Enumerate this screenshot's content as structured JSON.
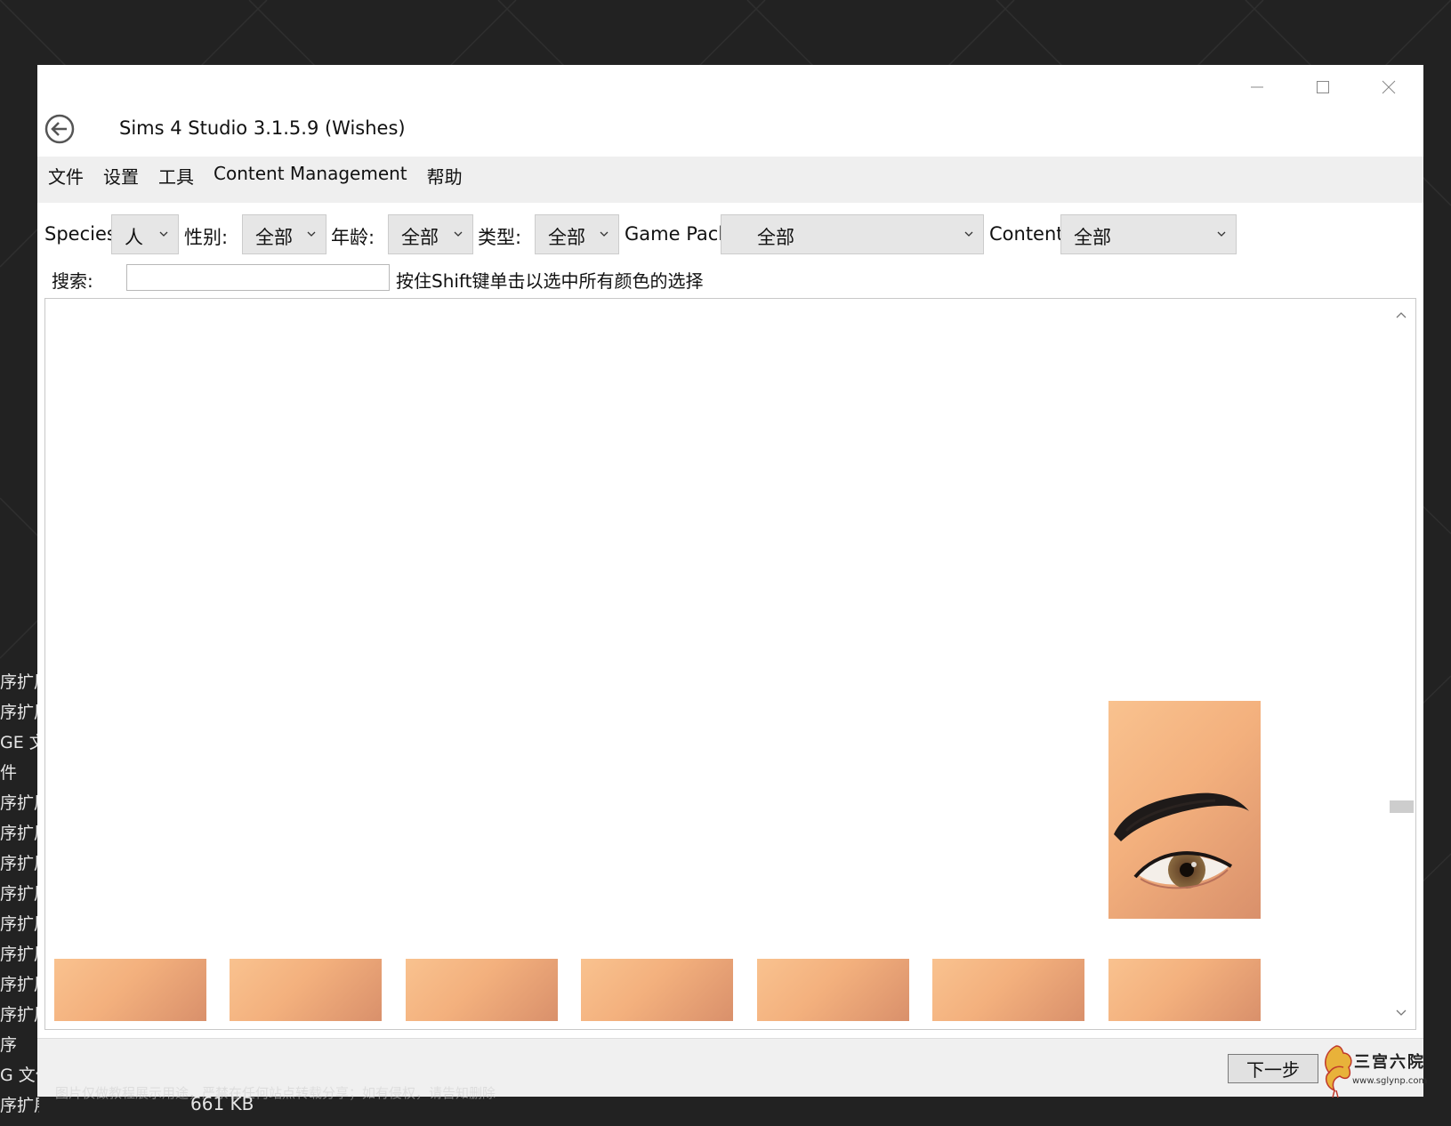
{
  "window": {
    "title": "Sims 4 Studio 3.1.5.9 (Wishes)"
  },
  "menu": [
    {
      "label": "文件"
    },
    {
      "label": "设置"
    },
    {
      "label": "工具"
    },
    {
      "label": "Content Management"
    },
    {
      "label": "帮助"
    }
  ],
  "filters": {
    "species": {
      "label": "Species",
      "value": "人"
    },
    "gender": {
      "label": "性别:",
      "value": "全部"
    },
    "age": {
      "label": "年龄:",
      "value": "全部"
    },
    "type": {
      "label": "类型:",
      "value": "全部"
    },
    "game_pack": {
      "label": "Game Pack",
      "value": "全部"
    },
    "content": {
      "label": "Content",
      "value": "全部"
    }
  },
  "search": {
    "label": "搜索:",
    "value": "",
    "hint": "按住Shift键单击以选中所有颜色的选择"
  },
  "footer": {
    "next_label": "下一步"
  },
  "desktop": {
    "items": [
      "序扩展",
      "序扩展",
      "GE 文",
      "件",
      "序扩展",
      "序扩展",
      "序扩展",
      "序扩展",
      "序扩展",
      "序扩展",
      "序扩展",
      "序扩展",
      "序",
      "G 文件",
      "序扩展"
    ],
    "size": "661 KB",
    "status": "图片仅做教程展示用途，严禁在任何站点转载分享；如有侵权，请告知删除"
  },
  "watermark": {
    "text": "三宫六院",
    "url": "www.sglynp.com"
  },
  "colors": {
    "desktop_bg": "#222222",
    "menubar_bg": "#efefef",
    "combo_bg": "#e6e6e6",
    "skin_tone": "#f3b07d"
  }
}
